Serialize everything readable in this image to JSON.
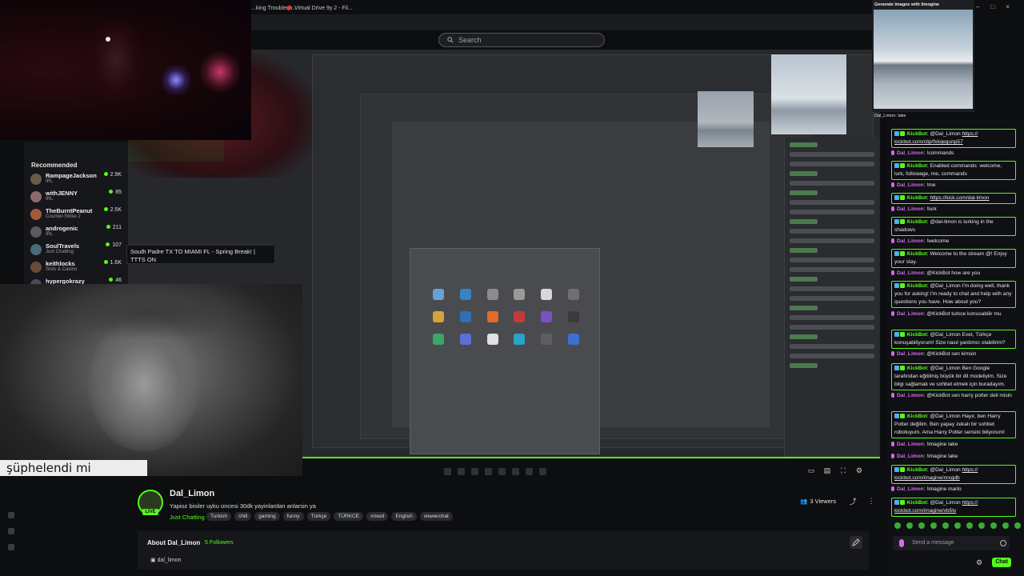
{
  "browser": {
    "tabs": [
      {
        "label": "...king Troublesh..."
      },
      {
        "label": "Virtual Drive 9y 2 - Fil..."
      }
    ],
    "search_placeholder": "Search",
    "window_controls": [
      "–",
      "□",
      "×"
    ]
  },
  "sidebar": {
    "heading": "Recommended",
    "items": [
      {
        "name": "RampageJackson",
        "category": "IRL",
        "viewers": "2.9K"
      },
      {
        "name": "withJENNY",
        "category": "IRL",
        "viewers": "85"
      },
      {
        "name": "TheBurntPeanut",
        "category": "Counter-Strike 2",
        "viewers": "2.5K"
      },
      {
        "name": "androgenic",
        "category": "IRL",
        "viewers": "211"
      },
      {
        "name": "SoulTravels",
        "category": "Just Chatting",
        "viewers": "107"
      },
      {
        "name": "keithlocks",
        "category": "Slots & Casino",
        "viewers": "1.6K"
      },
      {
        "name": "hypergokrazy",
        "category": "",
        "viewers": "46"
      }
    ],
    "tooltip": "South Padre TX TO MIAMI FL - Spring Break! | TTTS ON"
  },
  "overlay": {
    "subtitle": "şüphelendi mi"
  },
  "channel": {
    "live_badge": "LIVE",
    "name": "Dal_Limon",
    "title": "Yapioz bisiler uyku oncesi 30dk yayinlardan anlarsin ya",
    "category": "Just Chatting",
    "tags": [
      "Turkish",
      "chill",
      "gaming",
      "funny",
      "Türkçe",
      "TÜRKCE",
      "mixed",
      "English",
      "viewerchat"
    ],
    "viewers": "3 Viewers",
    "about_title": "About Dal_Limon",
    "followers": "5 Followers",
    "social_handle": "dal_limon"
  },
  "generator": {
    "header": "Generate images with limogine",
    "caption": "Dal_Limon: lake"
  },
  "chat": {
    "messages": [
      {
        "user": "KickBot",
        "text": "@Dal_Limon",
        "link": "https:// kickbot.com/clip/fxlojegunp57",
        "boxed": true
      },
      {
        "user": "Dal_Limon",
        "text": "!commands",
        "boxed": false
      },
      {
        "user": "KickBot",
        "text": "Enabled commands: welcome, lurk, followage, me, commands",
        "boxed": true
      },
      {
        "user": "Dal_Limon",
        "text": "!me",
        "boxed": false
      },
      {
        "user": "KickBot",
        "text": "",
        "link": "https://kick.com/dal-limon",
        "boxed": true
      },
      {
        "user": "Dal_Limon",
        "text": "!lurk",
        "boxed": false
      },
      {
        "user": "KickBot",
        "text": "@dal-limon is lurking in the shadows",
        "boxed": true
      },
      {
        "user": "Dal_Limon",
        "text": "!welcome",
        "boxed": false
      },
      {
        "user": "KickBot",
        "text": "Welcome to the stream @! Enjoy your stay.",
        "boxed": true
      },
      {
        "user": "Dal_Limon",
        "text": "@KickBot how are you",
        "boxed": false
      },
      {
        "user": "KickBot",
        "text": "@Dal_Limon I'm doing well, thank you for asking! I'm ready to chat and help with any questions you have. How about you?",
        "boxed": true
      },
      {
        "user": "Dal_Limon",
        "text": "@KickBot turkce konusabilir mu",
        "boxed": false
      },
      {
        "user": "KickBot",
        "text": "@Dal_Limon Evet, Türkçe konuşabiliyorum! Size nasıl yardımcı olabilirim?",
        "boxed": true
      },
      {
        "user": "Dal_Limon",
        "text": "@KickBot sen kimsin",
        "boxed": false
      },
      {
        "user": "KickBot",
        "text": "@Dal_Limon Ben Google tarafından eğitilmiş büyük bir dil modeliyim. Size bilgi sağlamak ve sohbet etmek için buradayım.",
        "boxed": true
      },
      {
        "user": "Dal_Limon",
        "text": "@KickBot sen harry potter deil misin",
        "boxed": false
      },
      {
        "user": "KickBot",
        "text": "@Dal_Limon Hayır, ben Harry Potter değilim. Ben yapay zekalı bir sohbet robotuyum. Ama Harry Potter serisini biliyorum!",
        "boxed": true
      },
      {
        "user": "Dal_Limon",
        "text": "!imagine lake",
        "boxed": false
      },
      {
        "user": "Dal_Limon",
        "text": "!imagine lake",
        "boxed": false
      },
      {
        "user": "KickBot",
        "text": "@Dal_Limon",
        "link": "https:// kickbot.com/imagine/nrxgdb",
        "boxed": true
      },
      {
        "user": "Dal_Limon",
        "text": "!imagine marlo",
        "boxed": false
      },
      {
        "user": "KickBot",
        "text": "@Dal_Limon",
        "link": "https:// kickbot.com/imagine/vb5tv",
        "boxed": true
      }
    ],
    "input_placeholder": "Send a message",
    "chat_button": "Chat"
  },
  "colors": {
    "accent": "#53fc18",
    "chat_user_dal": "#d36be8",
    "background": "#0d0e10"
  }
}
